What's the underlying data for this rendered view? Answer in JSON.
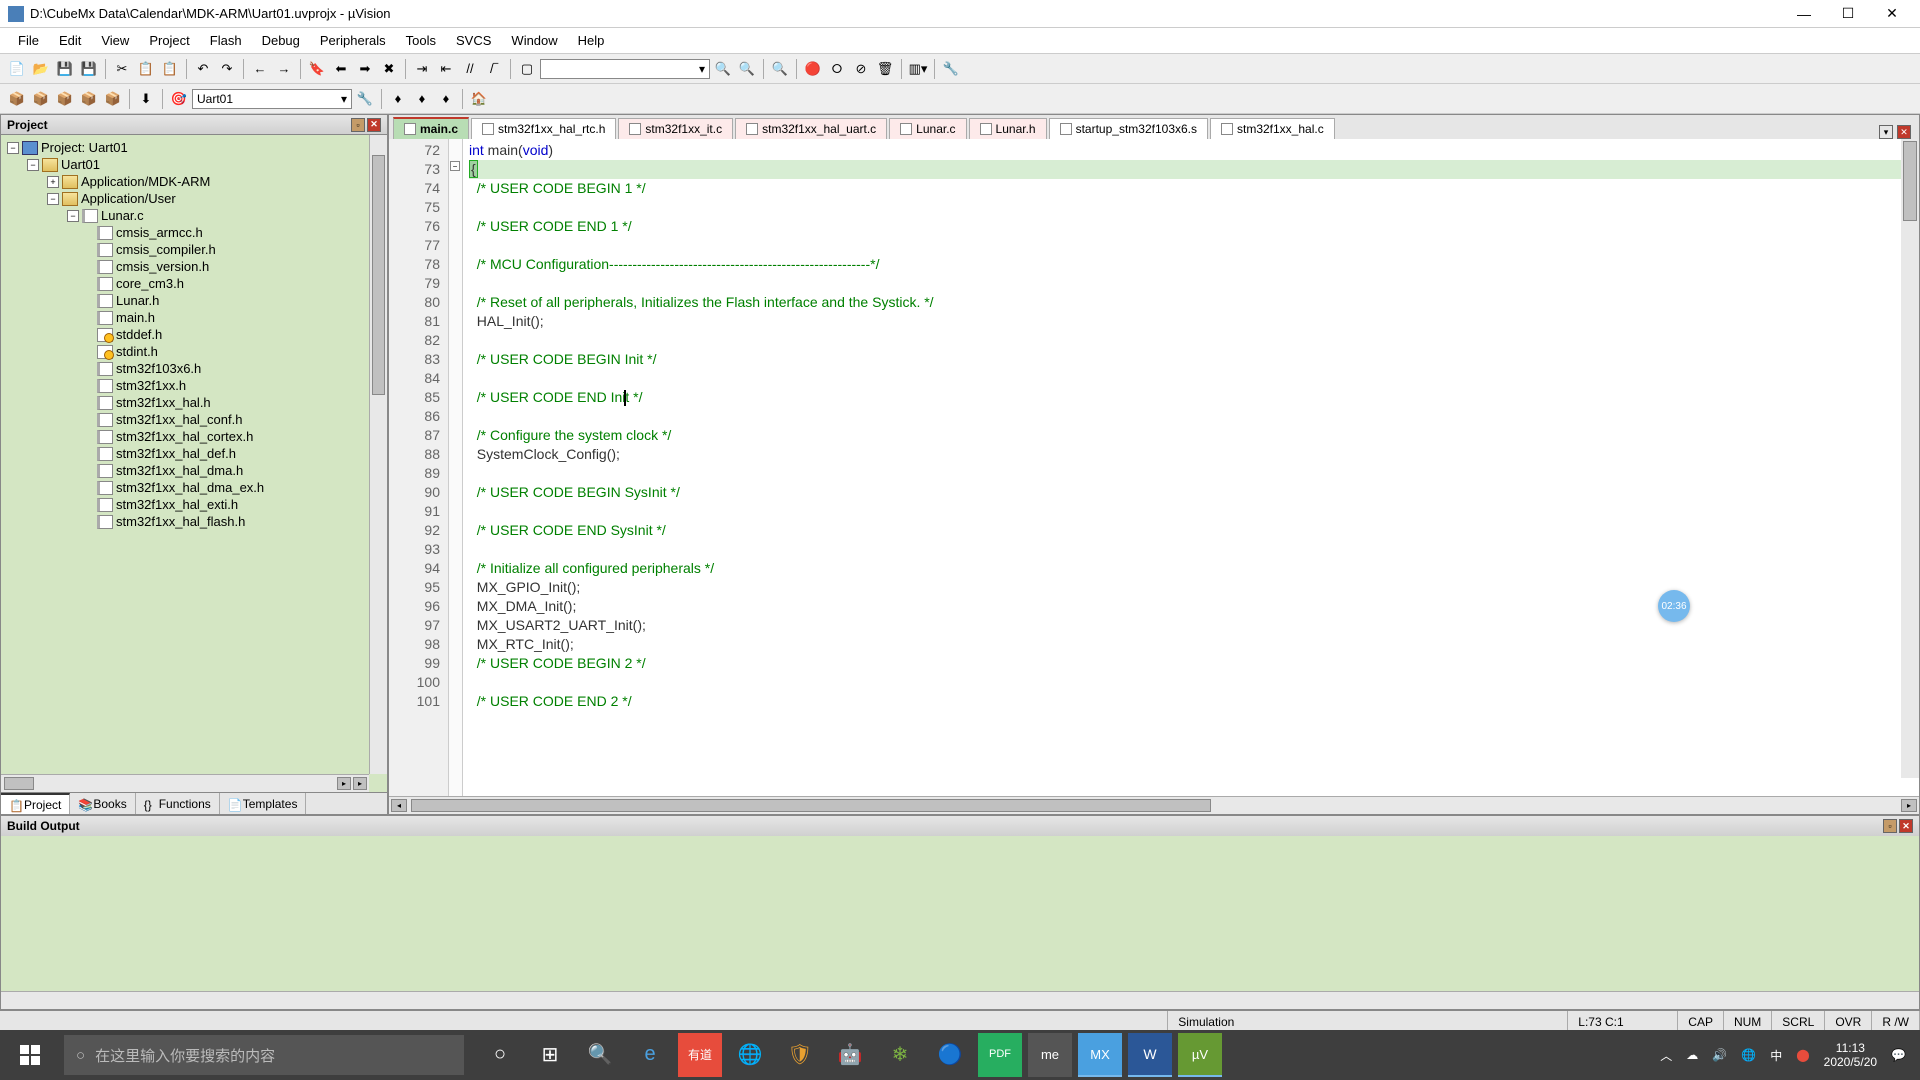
{
  "window": {
    "title": "D:\\CubeMx Data\\Calendar\\MDK-ARM\\Uart01.uvprojx - µVision"
  },
  "menus": [
    "File",
    "Edit",
    "View",
    "Project",
    "Flash",
    "Debug",
    "Peripherals",
    "Tools",
    "SVCS",
    "Window",
    "Help"
  ],
  "toolbar2_target": "Uart01",
  "project_panel": {
    "title": "Project",
    "root": "Project: Uart01",
    "target": "Uart01",
    "groups": [
      {
        "name": "Application/MDK-ARM"
      },
      {
        "name": "Application/User"
      }
    ],
    "open_file": "Lunar.c",
    "files": [
      "cmsis_armcc.h",
      "cmsis_compiler.h",
      "cmsis_version.h",
      "core_cm3.h",
      "Lunar.h",
      "main.h",
      "stddef.h",
      "stdint.h",
      "stm32f103x6.h",
      "stm32f1xx.h",
      "stm32f1xx_hal.h",
      "stm32f1xx_hal_conf.h",
      "stm32f1xx_hal_cortex.h",
      "stm32f1xx_hal_def.h",
      "stm32f1xx_hal_dma.h",
      "stm32f1xx_hal_dma_ex.h",
      "stm32f1xx_hal_exti.h",
      "stm32f1xx_hal_flash.h"
    ]
  },
  "panel_tabs": [
    "Project",
    "Books",
    "Functions",
    "Templates"
  ],
  "editor_tabs": [
    {
      "name": "main.c",
      "active": true
    },
    {
      "name": "stm32f1xx_hal_rtc.h",
      "mod": false
    },
    {
      "name": "stm32f1xx_it.c",
      "mod": true
    },
    {
      "name": "stm32f1xx_hal_uart.c",
      "mod": true
    },
    {
      "name": "Lunar.c",
      "mod": true
    },
    {
      "name": "Lunar.h",
      "mod": true
    },
    {
      "name": "startup_stm32f103x6.s",
      "mod": false
    },
    {
      "name": "stm32f1xx_hal.c",
      "mod": false
    }
  ],
  "code": {
    "first_line": 72,
    "lines": [
      {
        "n": 72,
        "raw": "int main(void)"
      },
      {
        "n": 73,
        "raw": "{",
        "hl": true
      },
      {
        "n": 74,
        "raw": "  /* USER CODE BEGIN 1 */",
        "c": true
      },
      {
        "n": 75,
        "raw": ""
      },
      {
        "n": 76,
        "raw": "  /* USER CODE END 1 */",
        "c": true
      },
      {
        "n": 77,
        "raw": ""
      },
      {
        "n": 78,
        "raw": "  /* MCU Configuration--------------------------------------------------------*/",
        "c": true
      },
      {
        "n": 79,
        "raw": ""
      },
      {
        "n": 80,
        "raw": "  /* Reset of all peripherals, Initializes the Flash interface and the Systick. */",
        "c": true
      },
      {
        "n": 81,
        "raw": "  HAL_Init();"
      },
      {
        "n": 82,
        "raw": ""
      },
      {
        "n": 83,
        "raw": "  /* USER CODE BEGIN Init */",
        "c": true
      },
      {
        "n": 84,
        "raw": ""
      },
      {
        "n": 85,
        "raw": "  /* USER CODE END Init */",
        "c": true,
        "cursor": true
      },
      {
        "n": 86,
        "raw": ""
      },
      {
        "n": 87,
        "raw": "  /* Configure the system clock */",
        "c": true
      },
      {
        "n": 88,
        "raw": "  SystemClock_Config();"
      },
      {
        "n": 89,
        "raw": ""
      },
      {
        "n": 90,
        "raw": "  /* USER CODE BEGIN SysInit */",
        "c": true
      },
      {
        "n": 91,
        "raw": ""
      },
      {
        "n": 92,
        "raw": "  /* USER CODE END SysInit */",
        "c": true
      },
      {
        "n": 93,
        "raw": ""
      },
      {
        "n": 94,
        "raw": "  /* Initialize all configured peripherals */",
        "c": true
      },
      {
        "n": 95,
        "raw": "  MX_GPIO_Init();"
      },
      {
        "n": 96,
        "raw": "  MX_DMA_Init();"
      },
      {
        "n": 97,
        "raw": "  MX_USART2_UART_Init();"
      },
      {
        "n": 98,
        "raw": "  MX_RTC_Init();"
      },
      {
        "n": 99,
        "raw": "  /* USER CODE BEGIN 2 */",
        "c": true
      },
      {
        "n": 100,
        "raw": ""
      },
      {
        "n": 101,
        "raw": "  /* USER CODE END 2 */",
        "c": true
      }
    ]
  },
  "build_output_title": "Build Output",
  "status": {
    "mode": "Simulation",
    "pos": "L:73 C:1",
    "caps": "CAP",
    "num": "NUM",
    "scrl": "SCRL",
    "ovr": "OVR",
    "rw": "R /W"
  },
  "taskbar": {
    "search_placeholder": "在这里输入你要搜索的内容",
    "time": "11:13",
    "date": "2020/5/20"
  },
  "badge": "02:36"
}
